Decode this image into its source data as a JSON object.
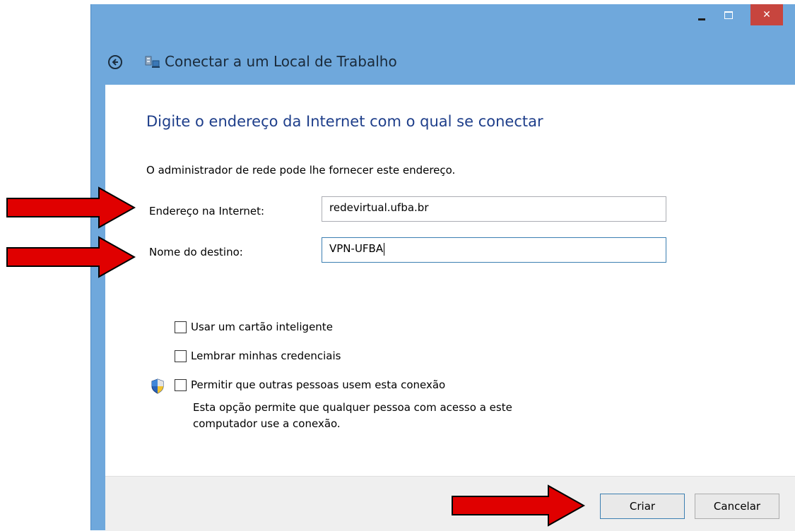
{
  "window": {
    "controls": {
      "minimize_icon": "minimize-icon",
      "maximize_icon": "maximize-icon",
      "close_glyph": "✕"
    }
  },
  "header": {
    "title": "Conectar a um Local de Trabalho",
    "back_icon": "back-arrow-icon",
    "app_icon": "network-workplace-icon"
  },
  "main": {
    "heading": "Digite o endereço da Internet com o qual se conectar",
    "description": "O administrador de rede pode lhe fornecer este endereço.",
    "internet_address": {
      "label": "Endereço na Internet:",
      "value": "redevirtual.ufba.br"
    },
    "destination_name": {
      "label": "Nome do destino:",
      "value": "VPN-UFBA"
    },
    "options": [
      {
        "label": "Usar um cartão inteligente",
        "checked": false
      },
      {
        "label": "Lembrar minhas credenciais",
        "checked": false
      },
      {
        "label": "Permitir que outras pessoas usem esta conexão",
        "checked": false,
        "icon": "uac-shield-icon"
      }
    ],
    "note_line1": "Esta opção permite que qualquer pessoa com acesso a este",
    "note_line2": "computador use a conexão."
  },
  "footer": {
    "create_label": "Criar",
    "cancel_label": "Cancelar"
  },
  "annotations": {
    "arrow_color": "#e00000",
    "icon": "red-arrow-icon"
  }
}
